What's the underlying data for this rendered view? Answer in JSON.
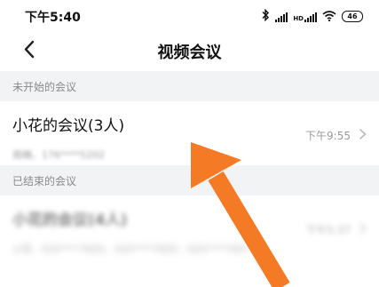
{
  "status_bar": {
    "time": "下午5:40",
    "battery": "46",
    "icons": [
      "bluetooth-icon",
      "signal-icon",
      "hd-signal-icon",
      "wifi-icon",
      "battery-icon"
    ]
  },
  "nav": {
    "title": "视频会议",
    "back_icon": "chevron-left-icon"
  },
  "sections": {
    "upcoming": {
      "header": "未开始的会议",
      "item": {
        "title": "小花的会议(3人)",
        "members": "周楠、176****5202",
        "time": "下午9:55"
      }
    },
    "ended": {
      "header": "已结束的会议",
      "item": {
        "title": "小花的会议(4人)",
        "members": "小花、020****7605、020****7605、020****7607",
        "time": "下午5:37"
      }
    }
  },
  "annotation": {
    "arrow_color": "#f57a25"
  }
}
